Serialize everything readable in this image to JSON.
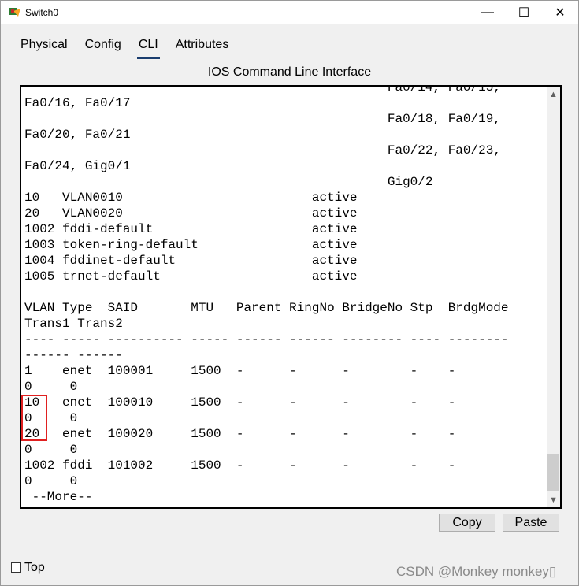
{
  "window": {
    "title": "Switch0",
    "controls": {
      "minimize": "—",
      "maximize": "☐",
      "close": "✕"
    }
  },
  "tabs": [
    {
      "label": "Physical",
      "active": false
    },
    {
      "label": "Config",
      "active": false
    },
    {
      "label": "CLI",
      "active": true
    },
    {
      "label": "Attributes",
      "active": false
    }
  ],
  "panel_title": "IOS Command Line Interface",
  "cli": {
    "text": "                                                Fa0/14, Fa0/15,\nFa0/16, Fa0/17\n                                                Fa0/18, Fa0/19,\nFa0/20, Fa0/21\n                                                Fa0/22, Fa0/23,\nFa0/24, Gig0/1\n                                                Gig0/2\n10   VLAN0010                         active\n20   VLAN0020                         active\n1002 fddi-default                     active\n1003 token-ring-default               active\n1004 fddinet-default                  active\n1005 trnet-default                    active\n\nVLAN Type  SAID       MTU   Parent RingNo BridgeNo Stp  BrdgMode\nTrans1 Trans2\n---- ----- ---------- ----- ------ ------ -------- ---- --------\n------ ------\n1    enet  100001     1500  -      -      -        -    -\n0     0\n10   enet  100010     1500  -      -      -        -    -\n0     0\n20   enet  100020     1500  -      -      -        -    -\n0     0\n1002 fddi  101002     1500  -      -      -        -    -\n0     0\n --More--"
  },
  "buttons": {
    "copy": "Copy",
    "paste": "Paste"
  },
  "footer": {
    "top_label": "Top",
    "top_checked": false
  },
  "watermark": "CSDN @Monkey monkey▯",
  "colors": {
    "highlight_box": "#e02020",
    "active_tab_underline": "#1a3d6e"
  }
}
